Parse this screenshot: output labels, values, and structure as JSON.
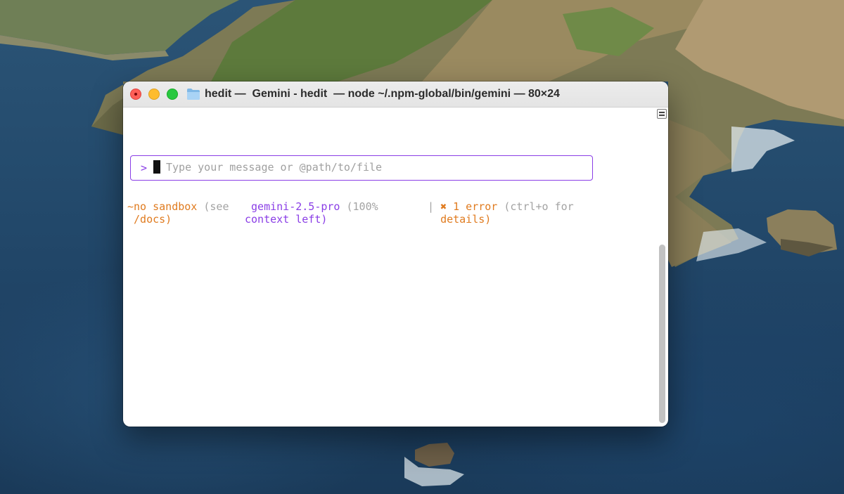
{
  "window": {
    "title": "hedit —  Gemini - hedit  — node ~/.npm-global/bin/gemini — 80×24"
  },
  "prompt": {
    "symbol": ">",
    "placeholder": "Type your message or @path/to/file",
    "value": ""
  },
  "status_bar": {
    "sandbox": {
      "tilde": "~",
      "label": "no sandbox",
      "hint": " (see",
      "link": " /docs)"
    },
    "model": {
      "name": " gemini-2.5-pro",
      "context_line1": " (100%",
      "context_line2": "context left)"
    },
    "errors": {
      "separator": "| ",
      "label": "✖ 1 error",
      "hint": " (ctrl+o for",
      "hint_line2": "details)"
    }
  },
  "colors": {
    "accent_purple": "#8a3ee6",
    "warning_orange": "#e07b1f",
    "muted_gray": "#a3a3a3",
    "close": "#fe5f57",
    "minimize": "#febc2e",
    "zoom": "#28c840"
  },
  "icons": [
    "folder-icon",
    "close-icon",
    "minimize-icon",
    "zoom-icon",
    "scrollbar-menu-icon"
  ]
}
